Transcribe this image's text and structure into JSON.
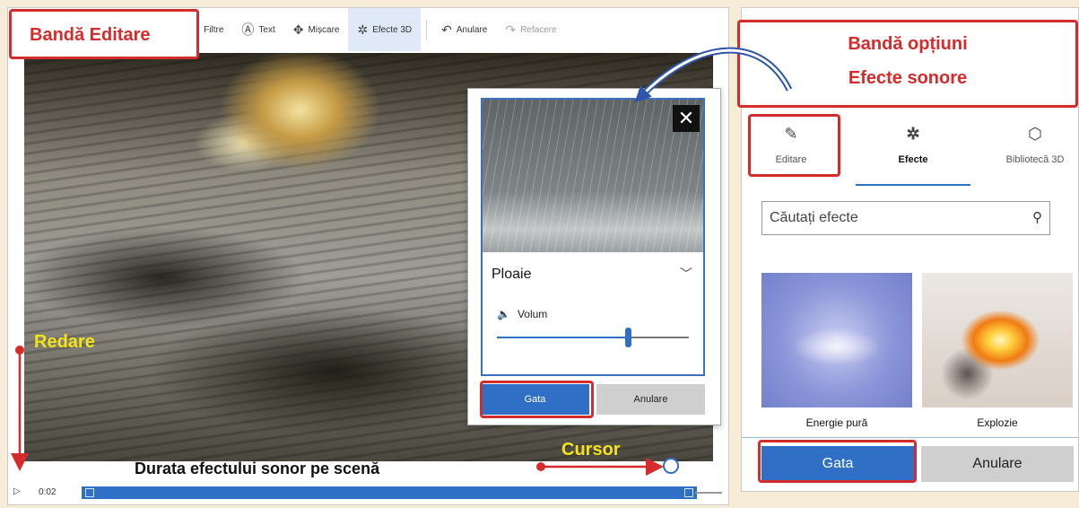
{
  "toolbar": {
    "items": [
      {
        "label": "Filtre",
        "icon": "filter-icon"
      },
      {
        "label": "Text",
        "icon": "text-icon"
      },
      {
        "label": "Mișcare",
        "icon": "motion-icon"
      },
      {
        "label": "Efecte 3D",
        "icon": "effects-3d-icon"
      },
      {
        "label": "Anulare",
        "icon": "undo-icon"
      },
      {
        "label": "Refacere",
        "icon": "redo-icon"
      }
    ]
  },
  "timeline": {
    "time": "0:02",
    "progress_fraction": 0.97
  },
  "popup": {
    "effect_name": "Ploaie",
    "volume_label": "Volum",
    "volume_fraction": 0.68,
    "done_label": "Gata",
    "cancel_label": "Anulare",
    "close_glyph": "✕"
  },
  "panel": {
    "tabs": [
      {
        "label": "Editare",
        "icon": "pencil-icon"
      },
      {
        "label": "Efecte",
        "icon": "effects-icon"
      },
      {
        "label": "Bibliotecă 3D",
        "icon": "cube-icon"
      }
    ],
    "active_tab": "Efecte",
    "search_placeholder": "Căutați efecte",
    "effects": [
      {
        "label": "Energie pură"
      },
      {
        "label": "Explozie"
      }
    ],
    "done_label": "Gata",
    "cancel_label": "Anulare"
  },
  "annotations": {
    "editing_band": "Bandă Editare",
    "options_band_line1": "Bandă opțiuni",
    "options_band_line2": "Efecte sonore",
    "playback": "Redare",
    "cursor": "Cursor",
    "duration": "Durata efectului sonor pe scenă"
  },
  "colors": {
    "accent": "#2f6fc6",
    "annotation_red": "#d62b2b",
    "annotation_yellow": "#f4e21a"
  }
}
